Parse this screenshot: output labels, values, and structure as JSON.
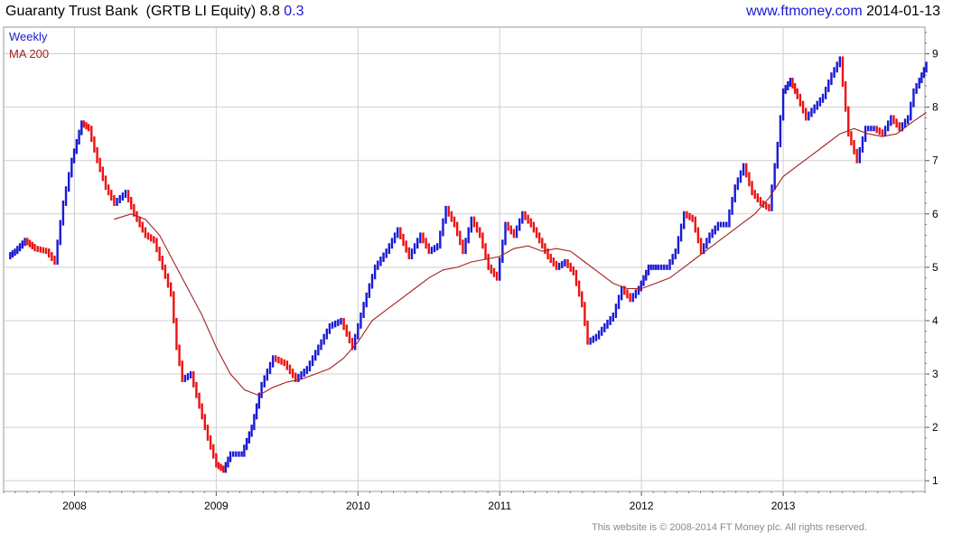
{
  "header": {
    "company": "Guaranty Trust Bank",
    "ticker": "(GRTB LI Equity)",
    "last_price": "8.8",
    "change": "0.3",
    "site": "www.ftmoney.com",
    "date": "2014-01-13"
  },
  "footer": {
    "copyright": "This website is © 2008-2014 FT Money plc. All rights reserved."
  },
  "colors": {
    "up": "#1a1ad6",
    "down": "#ee1111",
    "ma": "#a52020",
    "grid": "#cfcfcf",
    "frame": "#9a9a9a"
  },
  "chart_data": {
    "type": "line",
    "legend": {
      "position": "top-left",
      "entries": [
        "Weekly",
        "MA 200"
      ]
    },
    "x_ticks": [
      "2008",
      "2009",
      "2010",
      "2011",
      "2012",
      "2013"
    ],
    "xlim": [
      2007.5,
      2014.0
    ],
    "y_ticks": [
      "1",
      "2",
      "3",
      "4",
      "5",
      "6",
      "7",
      "8",
      "9"
    ],
    "ylim": [
      0.8,
      9.5
    ],
    "grid": true,
    "series": [
      {
        "name": "Weekly",
        "points": [
          [
            2007.53,
            5.2
          ],
          [
            2007.58,
            5.3
          ],
          [
            2007.65,
            5.5
          ],
          [
            2007.72,
            5.35
          ],
          [
            2007.8,
            5.3
          ],
          [
            2007.86,
            5.1
          ],
          [
            2007.92,
            6.2
          ],
          [
            2007.98,
            7.0
          ],
          [
            2008.05,
            7.7
          ],
          [
            2008.1,
            7.6
          ],
          [
            2008.16,
            7.0
          ],
          [
            2008.22,
            6.5
          ],
          [
            2008.28,
            6.2
          ],
          [
            2008.36,
            6.4
          ],
          [
            2008.42,
            6.0
          ],
          [
            2008.5,
            5.6
          ],
          [
            2008.56,
            5.5
          ],
          [
            2008.62,
            5.0
          ],
          [
            2008.68,
            4.5
          ],
          [
            2008.72,
            3.5
          ],
          [
            2008.76,
            2.9
          ],
          [
            2008.82,
            3.0
          ],
          [
            2008.88,
            2.4
          ],
          [
            2008.94,
            1.8
          ],
          [
            2009.0,
            1.3
          ],
          [
            2009.05,
            1.2
          ],
          [
            2009.1,
            1.5
          ],
          [
            2009.18,
            1.5
          ],
          [
            2009.25,
            2.0
          ],
          [
            2009.32,
            2.8
          ],
          [
            2009.4,
            3.3
          ],
          [
            2009.48,
            3.2
          ],
          [
            2009.56,
            2.9
          ],
          [
            2009.64,
            3.1
          ],
          [
            2009.72,
            3.5
          ],
          [
            2009.8,
            3.9
          ],
          [
            2009.88,
            4.0
          ],
          [
            2009.96,
            3.5
          ],
          [
            2010.04,
            4.3
          ],
          [
            2010.12,
            5.0
          ],
          [
            2010.2,
            5.3
          ],
          [
            2010.28,
            5.7
          ],
          [
            2010.36,
            5.2
          ],
          [
            2010.44,
            5.6
          ],
          [
            2010.5,
            5.3
          ],
          [
            2010.56,
            5.4
          ],
          [
            2010.62,
            6.1
          ],
          [
            2010.68,
            5.8
          ],
          [
            2010.74,
            5.3
          ],
          [
            2010.8,
            5.9
          ],
          [
            2010.86,
            5.6
          ],
          [
            2010.92,
            5.0
          ],
          [
            2010.98,
            4.8
          ],
          [
            2011.04,
            5.8
          ],
          [
            2011.1,
            5.6
          ],
          [
            2011.16,
            6.0
          ],
          [
            2011.22,
            5.8
          ],
          [
            2011.28,
            5.5
          ],
          [
            2011.34,
            5.2
          ],
          [
            2011.4,
            5.0
          ],
          [
            2011.46,
            5.1
          ],
          [
            2011.52,
            4.9
          ],
          [
            2011.58,
            4.3
          ],
          [
            2011.62,
            3.6
          ],
          [
            2011.68,
            3.7
          ],
          [
            2011.74,
            3.9
          ],
          [
            2011.8,
            4.1
          ],
          [
            2011.86,
            4.6
          ],
          [
            2011.92,
            4.4
          ],
          [
            2011.98,
            4.6
          ],
          [
            2012.05,
            5.0
          ],
          [
            2012.12,
            5.0
          ],
          [
            2012.18,
            5.0
          ],
          [
            2012.24,
            5.3
          ],
          [
            2012.3,
            6.0
          ],
          [
            2012.36,
            5.9
          ],
          [
            2012.42,
            5.3
          ],
          [
            2012.48,
            5.6
          ],
          [
            2012.54,
            5.8
          ],
          [
            2012.6,
            5.8
          ],
          [
            2012.66,
            6.5
          ],
          [
            2012.72,
            6.9
          ],
          [
            2012.78,
            6.4
          ],
          [
            2012.84,
            6.2
          ],
          [
            2012.9,
            6.1
          ],
          [
            2012.96,
            7.3
          ],
          [
            2013.0,
            8.3
          ],
          [
            2013.05,
            8.5
          ],
          [
            2013.1,
            8.2
          ],
          [
            2013.16,
            7.8
          ],
          [
            2013.22,
            8.0
          ],
          [
            2013.28,
            8.2
          ],
          [
            2013.34,
            8.6
          ],
          [
            2013.4,
            8.9
          ],
          [
            2013.46,
            7.5
          ],
          [
            2013.52,
            7.0
          ],
          [
            2013.58,
            7.6
          ],
          [
            2013.64,
            7.6
          ],
          [
            2013.7,
            7.5
          ],
          [
            2013.76,
            7.8
          ],
          [
            2013.82,
            7.6
          ],
          [
            2013.88,
            7.8
          ],
          [
            2013.92,
            8.3
          ],
          [
            2013.96,
            8.5
          ],
          [
            2014.01,
            8.8
          ]
        ]
      },
      {
        "name": "MA 200",
        "points": [
          [
            2008.28,
            5.9
          ],
          [
            2008.4,
            6.0
          ],
          [
            2008.5,
            5.9
          ],
          [
            2008.6,
            5.6
          ],
          [
            2008.7,
            5.1
          ],
          [
            2008.8,
            4.6
          ],
          [
            2008.9,
            4.1
          ],
          [
            2009.0,
            3.5
          ],
          [
            2009.1,
            3.0
          ],
          [
            2009.2,
            2.7
          ],
          [
            2009.3,
            2.6
          ],
          [
            2009.4,
            2.75
          ],
          [
            2009.5,
            2.85
          ],
          [
            2009.6,
            2.9
          ],
          [
            2009.7,
            3.0
          ],
          [
            2009.8,
            3.1
          ],
          [
            2009.9,
            3.3
          ],
          [
            2010.0,
            3.6
          ],
          [
            2010.1,
            4.0
          ],
          [
            2010.2,
            4.2
          ],
          [
            2010.3,
            4.4
          ],
          [
            2010.4,
            4.6
          ],
          [
            2010.5,
            4.8
          ],
          [
            2010.6,
            4.95
          ],
          [
            2010.7,
            5.0
          ],
          [
            2010.8,
            5.1
          ],
          [
            2010.9,
            5.15
          ],
          [
            2011.0,
            5.2
          ],
          [
            2011.1,
            5.35
          ],
          [
            2011.2,
            5.4
          ],
          [
            2011.3,
            5.3
          ],
          [
            2011.4,
            5.35
          ],
          [
            2011.5,
            5.3
          ],
          [
            2011.6,
            5.1
          ],
          [
            2011.7,
            4.9
          ],
          [
            2011.8,
            4.7
          ],
          [
            2011.9,
            4.6
          ],
          [
            2012.0,
            4.6
          ],
          [
            2012.1,
            4.7
          ],
          [
            2012.2,
            4.8
          ],
          [
            2012.3,
            5.0
          ],
          [
            2012.4,
            5.2
          ],
          [
            2012.5,
            5.4
          ],
          [
            2012.6,
            5.6
          ],
          [
            2012.7,
            5.8
          ],
          [
            2012.8,
            6.0
          ],
          [
            2012.9,
            6.3
          ],
          [
            2013.0,
            6.7
          ],
          [
            2013.1,
            6.9
          ],
          [
            2013.2,
            7.1
          ],
          [
            2013.3,
            7.3
          ],
          [
            2013.4,
            7.5
          ],
          [
            2013.5,
            7.6
          ],
          [
            2013.6,
            7.5
          ],
          [
            2013.7,
            7.45
          ],
          [
            2013.8,
            7.5
          ],
          [
            2013.9,
            7.7
          ],
          [
            2014.01,
            7.9
          ]
        ]
      }
    ]
  }
}
